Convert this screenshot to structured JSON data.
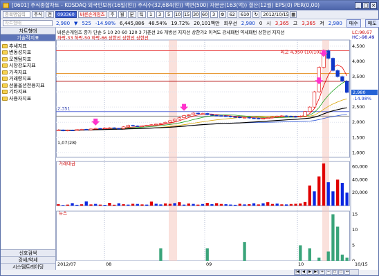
{
  "window": {
    "title": "[0601] 주식종합차트 - KOSDAQ 외국인보유(16일(현)) 주식수(32,684(현)) 액면(500) 자본금(163(억)) 결산(12월) EPS(0) PER(0,00)",
    "buttons": [
      "_",
      "□",
      "×"
    ]
  },
  "toolbar": {
    "code_placeholder": "종목명입력",
    "items": [
      "주식",
      "전",
      "093360",
      "바른손게임즈",
      "주",
      "월",
      "분",
      "틱"
    ],
    "periods": [
      "1",
      "3",
      "5",
      "10",
      "15",
      "30",
      "60",
      "3"
    ],
    "count": "62",
    "total": "610",
    "date": "2012/10/15"
  },
  "infobar": {
    "select_placeholder": "차트형태",
    "price": "2,980",
    "change": "525",
    "change_pct": "-14.98%",
    "volume": "6,445,886",
    "vol_pct": "48.54%",
    "turnover": "19.72%",
    "amount": "20,101백만",
    "prior_label": "회우선",
    "prior_value": "2,980",
    "zero": "0",
    "open_label": "시",
    "open": "3,365",
    "high_label": "고",
    "high": "3,365",
    "low_label": "저",
    "low": "2,980",
    "buy": "매수",
    "sell": "매도"
  },
  "sidebar": {
    "tabs": [
      "차트형태",
      "기술적지표"
    ],
    "items": [
      "추세지표",
      "변동성지표",
      "모멘텀지표",
      "시장강도지표",
      "가격지표",
      "거래량지표",
      "선물옵션전용지표",
      "기타지표",
      "사용자지표"
    ],
    "bottom": [
      "신호검색",
      "강세/약세",
      "시스템트레이딩"
    ]
  },
  "chart": {
    "legend1": "바른손게임즈 종가 단순 5  10  20  60  120  3  가준선 26  개방선  지지선  상한가2  이격도 강세패턴  약세패턴  상한선  지지선",
    "legend2": "하락-33  하락-50  하락-66  상한선  상한선  상한선",
    "high_label": "최고 4,350 (10/10)",
    "left_price_label": "2,351",
    "left_price_label2": "1,07(28)",
    "right_top_label": "LC:98.67",
    "right_top_label2": "HC:-98.49",
    "current_price_label": "2,980",
    "current_pct_label": "-14.98%",
    "volume_label": "거래대금",
    "news_label": "뉴스",
    "x_labels": [
      "2012/07",
      "08",
      "09",
      "10",
      "10/15"
    ]
  },
  "chart_data": [
    {
      "type": "line",
      "title": "바른손게임즈",
      "y_ticks": [
        1000,
        1500,
        2000,
        2500,
        3000,
        3500,
        4000,
        4500
      ],
      "ylim": [
        850,
        4700
      ],
      "close": [
        1750,
        1720,
        1740,
        1730,
        1760,
        1770,
        1750,
        1780,
        1800,
        1790,
        1810,
        1820,
        1800,
        1790,
        1850,
        1900,
        1880,
        1870,
        1880,
        1900,
        1920,
        1940,
        1960,
        2000,
        2050,
        2100,
        2150,
        2220,
        2250,
        2300,
        2280,
        2290,
        2250,
        2230,
        2220,
        2210,
        2200,
        2180,
        2170,
        2150,
        2160,
        2140,
        2130,
        2120,
        2130,
        2150,
        2180,
        2200,
        2210,
        2200,
        2190,
        2180,
        2200,
        2350,
        2500,
        3000,
        3800,
        4350,
        4100,
        3700,
        3500,
        3350,
        2980
      ]
    },
    {
      "type": "bar",
      "title": "거래대금",
      "y_ticks": [
        20000,
        40000,
        60000
      ],
      "ylim": [
        0,
        68000
      ],
      "values": [
        2100,
        900,
        1500,
        3800,
        1200,
        2000,
        6500,
        1800,
        2600,
        1500,
        1100,
        4200,
        1300,
        3600,
        2100,
        1500,
        2800,
        2500,
        1800,
        1500,
        6200,
        2900,
        1800,
        3400,
        2700,
        3800,
        5200,
        1500,
        3300,
        2600,
        1500,
        2400,
        4100,
        2200,
        3800,
        2500,
        2100,
        1600,
        1200,
        2800,
        1800,
        2200,
        3600,
        1800,
        3600,
        5200,
        2500,
        3200,
        1900,
        1800,
        2400,
        2800,
        3400,
        5500,
        31000,
        22000,
        45000,
        65000,
        36000,
        22000,
        40000,
        35000,
        20000
      ],
      "down": [
        0,
        1,
        0,
        1,
        1,
        0,
        1,
        0,
        1,
        0,
        1,
        0,
        0,
        1,
        0,
        1,
        0,
        1,
        0,
        1,
        0,
        1,
        1,
        0,
        0,
        1,
        0,
        1,
        0,
        1,
        0,
        1,
        0,
        1,
        0,
        0,
        1,
        1,
        1,
        0,
        1,
        0,
        1,
        0,
        1,
        0,
        0,
        1,
        0,
        1,
        0,
        0,
        0,
        0,
        0,
        1,
        0,
        0,
        1,
        1,
        0,
        1,
        1
      ]
    },
    {
      "type": "bar",
      "title": "뉴스",
      "y_ticks": [
        0,
        5,
        10,
        15
      ],
      "ylim": [
        0,
        16
      ],
      "values": [
        0,
        0,
        0,
        0,
        0,
        0,
        0,
        0,
        0,
        0,
        0,
        0,
        0,
        0,
        0,
        0,
        0,
        0,
        0,
        0,
        0,
        0,
        4,
        0,
        0,
        0,
        0,
        0,
        0,
        0,
        0,
        0,
        4,
        0,
        0,
        0,
        0,
        0,
        0,
        0,
        6,
        0,
        0,
        0,
        0,
        0,
        0,
        0,
        0,
        0,
        0,
        0,
        5,
        0,
        4,
        0,
        1,
        0,
        3,
        15,
        11,
        2,
        1
      ]
    }
  ]
}
